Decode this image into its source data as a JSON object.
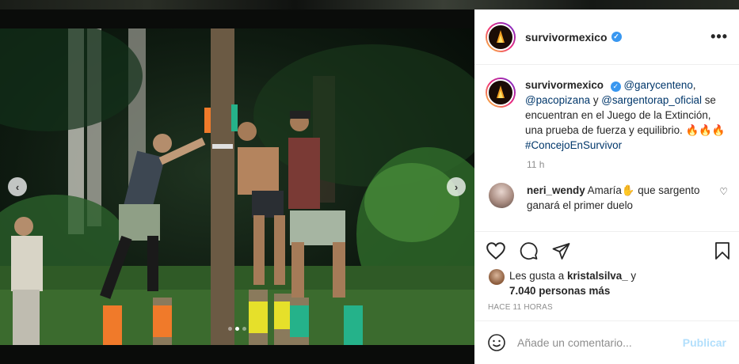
{
  "post": {
    "username": "survivormexico",
    "caption": {
      "username": "survivormexico",
      "mention1": "@garycenteno",
      "sep1": ",",
      "mention2": "@pacopizana",
      "connector": " y ",
      "mention3": "@sargentorap_oficial",
      "body": " se encuentran en el Juego de la Extinción, una prueba de fuerza y equilibrio. 🔥🔥🔥 ",
      "hashtag": "#ConcejoEnSurvivor"
    },
    "caption_time": "11 h",
    "comment": {
      "username": "neri_wendy",
      "text": " Amaría✋ que sargento ganará el primer duelo"
    },
    "likes": {
      "prefix": "Les gusta a ",
      "user": "kristalsilva_",
      "connector": " y ",
      "count": "7.040 personas más"
    },
    "posted_ago": "HACE 11 HORAS",
    "comment_input_placeholder": "Añade un comentario...",
    "publish_label": "Publicar"
  },
  "carousel": {
    "prev": "‹",
    "next": "›",
    "total_slides": 3,
    "active_slide": 2
  },
  "icons": {
    "verified": "verified-badge-icon",
    "more": "more-options-icon",
    "heart": "heart-icon",
    "comment": "comment-icon",
    "share": "share-icon",
    "save": "bookmark-icon",
    "emoji": "emoji-icon"
  },
  "glyphs": {
    "verified_check": "✓",
    "more": "•••",
    "small_heart": "♡"
  },
  "colors": {
    "accent": "#3897f0",
    "mention": "#00376b",
    "publish_disabled": "#b2dffc",
    "muted": "#8e8e8e"
  }
}
